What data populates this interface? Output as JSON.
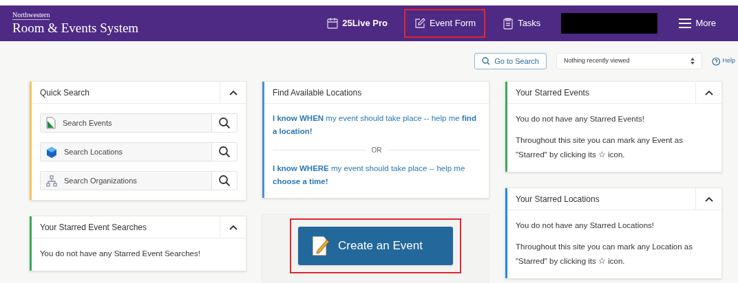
{
  "header": {
    "org": "Northwestern",
    "title": "Room & Events System",
    "nav": [
      {
        "kind": "calendar",
        "label": "25Live Pro",
        "highlighted": false
      },
      {
        "kind": "form",
        "label": "Event Form",
        "highlighted": true
      },
      {
        "kind": "tasks",
        "label": "Tasks",
        "highlighted": false
      },
      {
        "kind": "redacted"
      },
      {
        "kind": "menu",
        "label": "More",
        "highlighted": false
      }
    ]
  },
  "toolbar": {
    "search_button": "Go to Search",
    "recent": {
      "value": "Nothing recently viewed"
    },
    "help": "Help"
  },
  "columns": [
    [
      {
        "kind": "search",
        "title": "Quick Search",
        "color": "#f0c75e",
        "collapsible": true,
        "items": [
          {
            "kind": "document",
            "label": "Search Events"
          },
          {
            "kind": "cube",
            "label": "Search Locations"
          },
          {
            "kind": "org",
            "label": "Search Organizations"
          }
        ]
      },
      {
        "kind": "message",
        "title": "Your Starred Event Searches",
        "color": "#3aa757",
        "collapsible": true,
        "paragraphs": [
          "You do not have any Starred Event Searches!"
        ]
      }
    ],
    [
      {
        "kind": "find",
        "title": "Find Available Locations",
        "color": "#4a90d9",
        "collapsible": false,
        "options": [
          "**I know WHEN** my event should take place -- help me **find a location!**",
          "**I know WHERE** my event should take place -- help me **choose a time!**"
        ],
        "divider": "OR"
      },
      {
        "kind": "create",
        "button": "Create an Event",
        "highlighted": true
      }
    ],
    [
      {
        "kind": "message",
        "title": "Your Starred Events",
        "color": "#3aa757",
        "collapsible": true,
        "paragraphs": [
          "You do not have any Starred Events!",
          "Throughout this site you can mark any Event as \"Starred\" by clicking its ☆ icon."
        ]
      },
      {
        "kind": "message",
        "title": "Your Starred Locations",
        "color": "#1e88e5",
        "collapsible": true,
        "paragraphs": [
          "You do not have any Starred Locations!",
          "Throughout this site you can mark any Location as \"Starred\" by clicking its ☆ icon."
        ]
      }
    ]
  ]
}
